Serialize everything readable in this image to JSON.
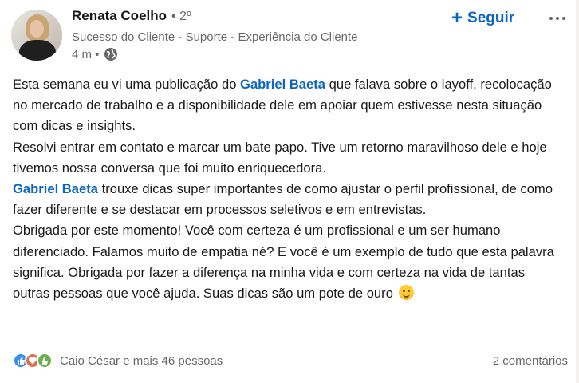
{
  "author": {
    "name": "Renata Coelho",
    "degree": "• 2º",
    "headline": "Sucesso do Cliente - Suporte - Experiência do Cliente",
    "time": "4 m •",
    "avatar_icon": "profile-photo"
  },
  "actions": {
    "follow_icon": "+",
    "follow_label": "Seguir",
    "more_icon": "more-dots-icon"
  },
  "post": {
    "p1_a": "Esta semana eu vi uma publicação do ",
    "mention1": "Gabriel Baeta",
    "p1_b": " que falava sobre o layoff, recolocação no mercado de trabalho e a disponibilidade dele em apoiar quem estivesse nesta situação com dicas e insights.",
    "p2": "Resolvi entrar em contato e marcar um bate papo. Tive um retorno maravilhoso dele e hoje tivemos nossa conversa que foi muito enriquecedora.",
    "mention2": "Gabriel Baeta",
    "p3": " trouxe dicas super importantes de como ajustar o perfil profissional, de como fazer diferente e se destacar em processos seletivos e em entrevistas.",
    "p4": "Obrigada por este momento! Você com certeza é um profissional e um ser humano diferenciado. Falamos muito de empatia né? E você é um exemplo de tudo que esta palavra significa. Obrigada por fazer a diferença na minha vida e com certeza na vida de tantas outras pessoas que você ajuda. Suas dicas são um pote de ouro",
    "emoji": "smiling-face-emoji"
  },
  "social": {
    "reactions": [
      "like-icon",
      "love-icon",
      "support-icon"
    ],
    "reactors_text": "Caio César e mais 46 pessoas",
    "comments_text": "2 comentários"
  },
  "colors": {
    "link": "#0a66c2",
    "text": "#191919",
    "muted": "#666666",
    "like": "#378fe9",
    "love": "#df704d",
    "support": "#6dae4f"
  }
}
